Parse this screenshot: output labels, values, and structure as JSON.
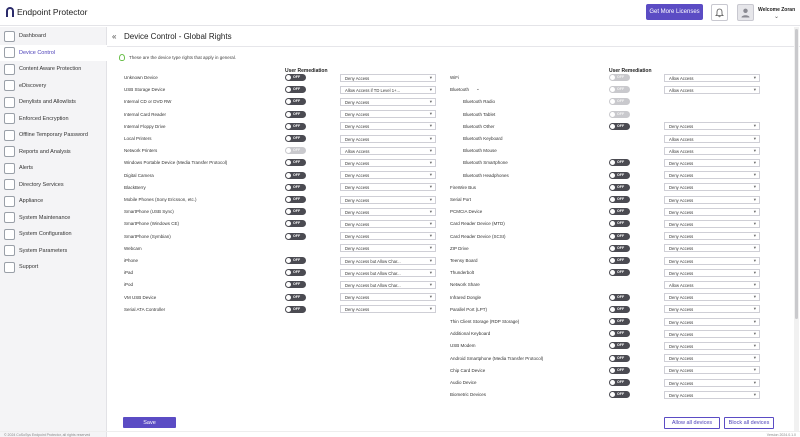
{
  "app": {
    "logo_text": "Endpoint Protector"
  },
  "header": {
    "get_licenses": "Get More Licenses",
    "welcome": "Welcome Zoran",
    "chevron": "⌄"
  },
  "sidebar": {
    "items": [
      {
        "label": "Dashboard"
      },
      {
        "label": "Device Control"
      },
      {
        "label": "Content Aware Protection"
      },
      {
        "label": "eDiscovery"
      },
      {
        "label": "Denylists and Allowlists"
      },
      {
        "label": "Enforced Encryption"
      },
      {
        "label": "Offline Temporary Password"
      },
      {
        "label": "Reports and Analysis"
      },
      {
        "label": "Alerts"
      },
      {
        "label": "Directory Services"
      },
      {
        "label": "Appliance"
      },
      {
        "label": "System Maintenance"
      },
      {
        "label": "System Configuration"
      },
      {
        "label": "System Parameters"
      },
      {
        "label": "Support"
      }
    ],
    "active_index": 1
  },
  "page": {
    "back": "«",
    "title": "Device Control - Global Rights",
    "info": "These are the device type rights that apply in general.",
    "col_user_remediation": "User Remediation"
  },
  "toggle_off": "OFF",
  "select_chevron": "▾",
  "left_devices": [
    {
      "name": "Unknown Device",
      "toggle": "on",
      "value": "Deny Access"
    },
    {
      "name": "USB Storage Device",
      "toggle": "on",
      "value": "Allow Access if TD Level 1+..."
    },
    {
      "name": "Internal CD or DVD RW",
      "toggle": "on",
      "value": "Deny Access"
    },
    {
      "name": "Internal Card Reader",
      "toggle": "on",
      "value": "Deny Access"
    },
    {
      "name": "Internal Floppy Drive",
      "toggle": "on",
      "value": "Deny Access"
    },
    {
      "name": "Local Printers",
      "toggle": "on",
      "value": "Deny Access"
    },
    {
      "name": "Network Printers",
      "toggle": "disabled",
      "value": "Allow Access"
    },
    {
      "name": "Windows Portable Device (Media Transfer Protocol)",
      "toggle": "on",
      "value": "Deny Access"
    },
    {
      "name": "Digital Camera",
      "toggle": "on",
      "value": "Deny Access"
    },
    {
      "name": "BlackBerry",
      "toggle": "on",
      "value": "Deny Access"
    },
    {
      "name": "Mobile Phones (Sony Ericsson, etc.)",
      "toggle": "on",
      "value": "Deny Access"
    },
    {
      "name": "SmartPhone (USB Sync)",
      "toggle": "on",
      "value": "Deny Access"
    },
    {
      "name": "SmartPhone (Windows CE)",
      "toggle": "on",
      "value": "Deny Access"
    },
    {
      "name": "SmartPhone (Symbian)",
      "toggle": "on",
      "value": "Deny Access"
    },
    {
      "name": "Webcam",
      "toggle": "none",
      "value": "Deny Access"
    },
    {
      "name": "iPhone",
      "toggle": "on",
      "value": "Deny Access but Allow Char..."
    },
    {
      "name": "iPad",
      "toggle": "on",
      "value": "Deny Access but Allow Char..."
    },
    {
      "name": "iPod",
      "toggle": "on",
      "value": "Deny Access but Allow Char..."
    },
    {
      "name": "VM USB Device",
      "toggle": "on",
      "value": "Deny Access"
    },
    {
      "name": "Serial ATA Controller",
      "toggle": "on",
      "value": "Deny Access"
    }
  ],
  "right_devices": [
    {
      "name": "WiFi",
      "toggle": "disabled",
      "value": "Allow Access",
      "indent": 0
    },
    {
      "name": "Bluetooth",
      "toggle": "disabled",
      "value": "Allow Access",
      "indent": 0,
      "expand": "⌄"
    },
    {
      "name": "Bluetooth Radio",
      "toggle": "disabled",
      "value": "",
      "indent": 1
    },
    {
      "name": "Bluetooth Tablet",
      "toggle": "disabled",
      "value": "",
      "indent": 1
    },
    {
      "name": "Bluetooth Other",
      "toggle": "on",
      "value": "Deny Access",
      "indent": 1
    },
    {
      "name": "Bluetooth Keyboard",
      "toggle": "none",
      "value": "Allow Access",
      "indent": 1
    },
    {
      "name": "Bluetooth Mouse",
      "toggle": "none",
      "value": "Allow Access",
      "indent": 1
    },
    {
      "name": "Bluetooth Smartphone",
      "toggle": "on",
      "value": "Deny Access",
      "indent": 1
    },
    {
      "name": "Bluetooth Headphones",
      "toggle": "on",
      "value": "Deny Access",
      "indent": 1
    },
    {
      "name": "FireWire Bus",
      "toggle": "on",
      "value": "Deny Access",
      "indent": 0
    },
    {
      "name": "Serial Port",
      "toggle": "on",
      "value": "Deny Access",
      "indent": 0
    },
    {
      "name": "PCMCIA Device",
      "toggle": "on",
      "value": "Deny Access",
      "indent": 0
    },
    {
      "name": "Card Reader Device (MTD)",
      "toggle": "on",
      "value": "Deny Access",
      "indent": 0
    },
    {
      "name": "Card Reader Device (SCSI)",
      "toggle": "on",
      "value": "Deny Access",
      "indent": 0
    },
    {
      "name": "ZIP Drive",
      "toggle": "on",
      "value": "Deny Access",
      "indent": 0
    },
    {
      "name": "Teensy Board",
      "toggle": "on",
      "value": "Deny Access",
      "indent": 0
    },
    {
      "name": "Thunderbolt",
      "toggle": "on",
      "value": "Deny Access",
      "indent": 0
    },
    {
      "name": "Network Share",
      "toggle": "none",
      "value": "Allow Access",
      "indent": 0
    },
    {
      "name": "Infrared Dongle",
      "toggle": "on",
      "value": "Deny Access",
      "indent": 0
    },
    {
      "name": "Parallel Port (LPT)",
      "toggle": "on",
      "value": "Deny Access",
      "indent": 0
    },
    {
      "name": "Thin Client Storage (RDP Storage)",
      "toggle": "on",
      "value": "Deny Access",
      "indent": 0
    },
    {
      "name": "Additional Keyboard",
      "toggle": "on",
      "value": "Deny Access",
      "indent": 0
    },
    {
      "name": "USB Modem",
      "toggle": "on",
      "value": "Deny Access",
      "indent": 0
    },
    {
      "name": "Android Smartphone (Media Transfer Protocol)",
      "toggle": "on",
      "value": "Deny Access",
      "indent": 0
    },
    {
      "name": "Chip Card Device",
      "toggle": "on",
      "value": "Deny Access",
      "indent": 0
    },
    {
      "name": "Audio Device",
      "toggle": "on",
      "value": "Deny Access",
      "indent": 0
    },
    {
      "name": "Biometric Devices",
      "toggle": "on",
      "value": "Deny Access",
      "indent": 0
    }
  ],
  "actions": {
    "save": "Save",
    "allow_all": "Allow all devices",
    "block_all": "Block all devices"
  },
  "footer": {
    "left": "© 2024 CoSoSys Endpoint Protector, all rights reserved",
    "right": "Version 2024.0.1.0"
  },
  "colors": {
    "accent": "#5b4cc4",
    "toggle_on": "#4b4b52",
    "toggle_disabled": "#c9c9cd"
  }
}
